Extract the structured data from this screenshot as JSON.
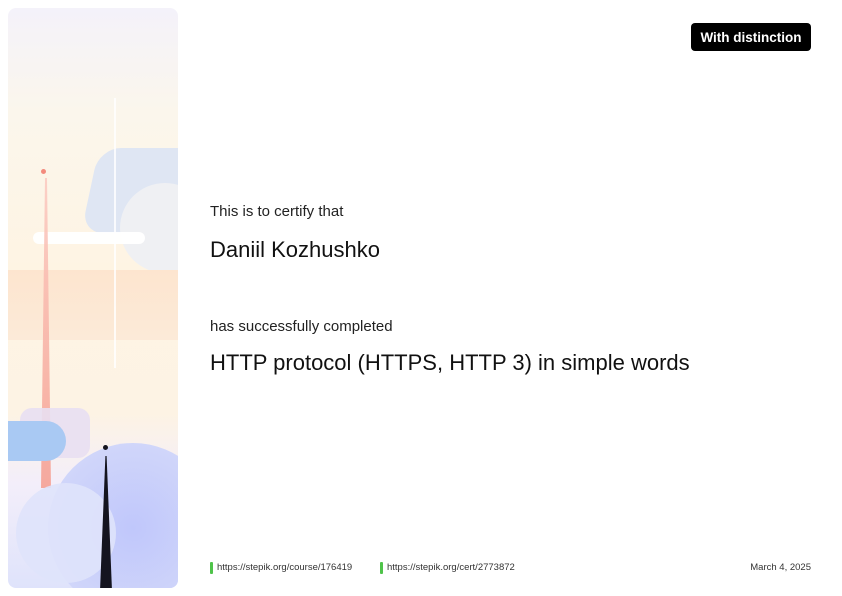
{
  "badge": "With distinction",
  "certificate": {
    "intro": "This is to certify that",
    "recipient": "Daniil Kozhushko",
    "completed_text": "has successfully completed",
    "course_title": "HTTP protocol (HTTPS, HTTP 3) in simple words"
  },
  "footer": {
    "course_url": "https://stepik.org/course/176419",
    "cert_url": "https://stepik.org/cert/2773872",
    "date": "March 4, 2025"
  },
  "colors": {
    "badge_bg": "#000000",
    "link_marker": "#4fc34a",
    "text": "#111111"
  }
}
